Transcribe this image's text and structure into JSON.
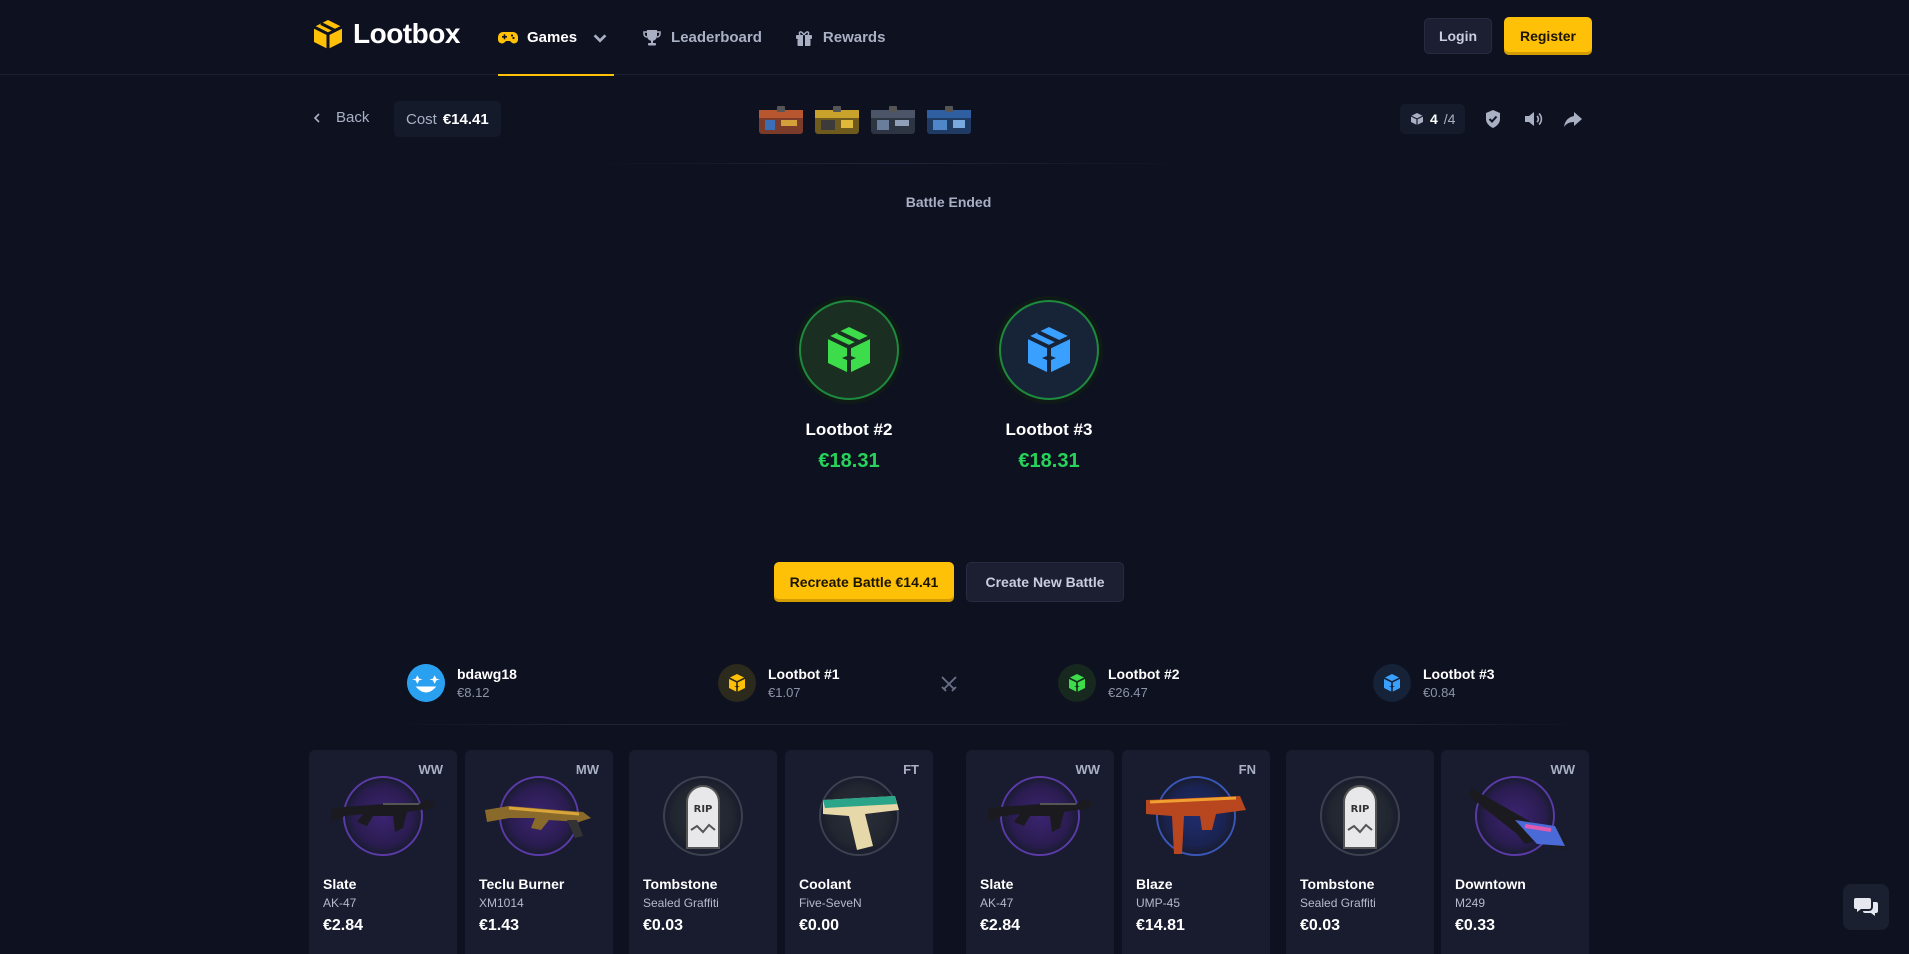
{
  "nav": {
    "brand": "Lootbox",
    "links": [
      {
        "label": "Games",
        "icon": "gamepad-icon"
      },
      {
        "label": "Leaderboard",
        "icon": "trophy-icon"
      },
      {
        "label": "Rewards",
        "icon": "gift-icon"
      }
    ],
    "login_label": "Login",
    "register_label": "Register"
  },
  "toolbar": {
    "back_label": "Back",
    "cost_label": "Cost",
    "cost_value": "€14.41",
    "rounds_current": "4",
    "rounds_total": "/4"
  },
  "battle": {
    "status": "Battle Ended",
    "winners": [
      {
        "name": "Lootbot #2",
        "amount": "€18.31",
        "color": "#3ddc4a"
      },
      {
        "name": "Lootbot #3",
        "amount": "€18.31",
        "color": "#3aa0ff"
      }
    ],
    "recreate_label": "Recreate Battle €14.41",
    "create_label": "Create New Battle"
  },
  "players": [
    {
      "name": "bdawg18",
      "value": "€8.12"
    },
    {
      "name": "Lootbot #1",
      "value": "€1.07"
    },
    {
      "name": "Lootbot #2",
      "value": "€26.47"
    },
    {
      "name": "Lootbot #3",
      "value": "€0.84"
    }
  ],
  "items": [
    {
      "name": "Slate",
      "type": "AK-47",
      "price": "€2.84",
      "condition": "WW"
    },
    {
      "name": "Teclu Burner",
      "type": "XM1014",
      "price": "€1.43",
      "condition": "MW"
    },
    {
      "name": "Tombstone",
      "type": "Sealed Graffiti",
      "price": "€0.03",
      "condition": ""
    },
    {
      "name": "Coolant",
      "type": "Five-SeveN",
      "price": "€0.00",
      "condition": "FT"
    },
    {
      "name": "Slate",
      "type": "AK-47",
      "price": "€2.84",
      "condition": "WW"
    },
    {
      "name": "Blaze",
      "type": "UMP-45",
      "price": "€14.81",
      "condition": "FN"
    },
    {
      "name": "Tombstone",
      "type": "Sealed Graffiti",
      "price": "€0.03",
      "condition": ""
    },
    {
      "name": "Downtown",
      "type": "M249",
      "price": "€0.33",
      "condition": "WW"
    }
  ],
  "colors": {
    "accent": "#ffc107",
    "win_green": "#27d35a",
    "background": "#0e1120",
    "card": "#181c2e"
  }
}
